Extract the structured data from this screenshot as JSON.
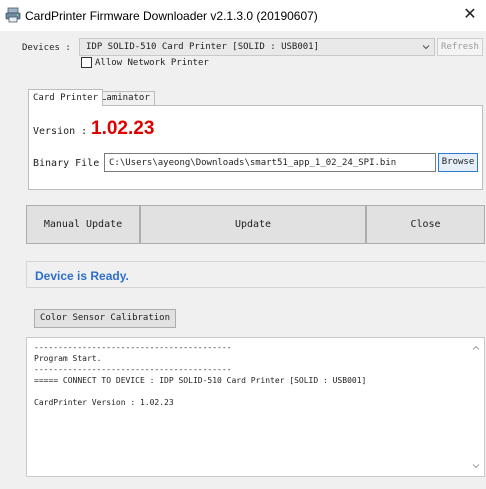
{
  "window": {
    "title": "CardPrinter Firmware Downloader v2.1.3.0 (20190607)",
    "close_glyph": "✕"
  },
  "devices": {
    "label": "Devices :",
    "selected": "IDP SOLID-510 Card Printer  [SOLID : USB001]",
    "refresh_label": "Refresh",
    "allow_network_label": "Allow Network Printer"
  },
  "tabs": [
    {
      "label": "Card Printer",
      "active": true
    },
    {
      "label": "Laminator",
      "active": false
    }
  ],
  "card_printer": {
    "version_label": "Version :",
    "version_value": "1.02.23",
    "binary_label": "Binary File :",
    "binary_path": "C:\\Users\\ayeong\\Downloads\\smart51_app_1_02_24_SPI.bin",
    "browse_label": "Browse"
  },
  "actions": {
    "manual_update": "Manual Update",
    "update": "Update",
    "close": "Close"
  },
  "status": {
    "text": "Device is Ready.",
    "color": "#2e6fcc"
  },
  "calibration": {
    "label": "Color Sensor Calibration"
  },
  "log": {
    "lines": [
      "-----------------------------------------",
      "Program Start.",
      "-----------------------------------------",
      "===== CONNECT TO DEVICE : IDP SOLID-510 Card Printer  [SOLID : USB001]",
      "",
      "CardPrinter Version : 1.02.23"
    ]
  },
  "icons": {
    "app": "printer-icon",
    "combo": "chevron-down-icon",
    "scroll_up": "chevron-up-icon",
    "scroll_down": "chevron-down-icon"
  },
  "colors": {
    "version": "#e00000",
    "accent_border": "#2f7bd1"
  }
}
